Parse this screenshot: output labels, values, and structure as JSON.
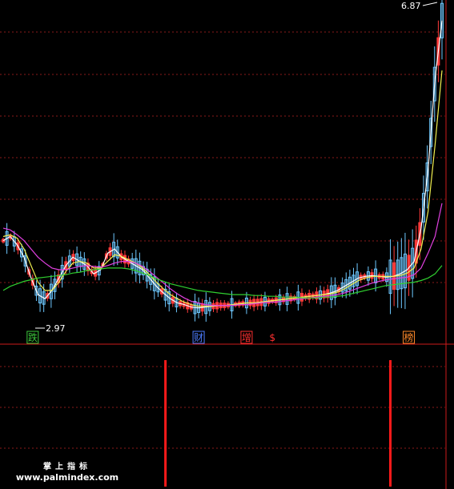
{
  "colors": {
    "background": "#000000",
    "grid": "#8a1a1a",
    "up_candle": "#6ec8ff",
    "down_candle": "#ff3b3b",
    "ma_white": "#ffffff",
    "ma_yellow": "#f0f050",
    "ma_magenta": "#e040e0",
    "ma_green": "#30d030",
    "volume_bar": "#ff1a1a",
    "marker_green": "#3cc83c",
    "marker_blue": "#4c7cff",
    "marker_red": "#ff3030",
    "marker_orange": "#ff8a2a"
  },
  "chart_data": [
    {
      "type": "candlestick",
      "title": "",
      "high_label": "6.87",
      "low_label": "2.97",
      "ylim": [
        2.9,
        6.9
      ],
      "grid": true,
      "x_count": 120,
      "series": [
        {
          "name": "",
          "color_key": "ma_white",
          "values": [
            4.05,
            4.1,
            4.0,
            3.85,
            3.6,
            3.4,
            3.35,
            3.45,
            3.6,
            3.75,
            3.85,
            3.8,
            3.75,
            3.65,
            3.7,
            3.9,
            3.95,
            3.85,
            3.8,
            3.75,
            3.7,
            3.6,
            3.5,
            3.42,
            3.35,
            3.3,
            3.28,
            3.25,
            3.24,
            3.25,
            3.26,
            3.27,
            3.27,
            3.28,
            3.29,
            3.3,
            3.3,
            3.31,
            3.32,
            3.33,
            3.34,
            3.35,
            3.36,
            3.37,
            3.38,
            3.39,
            3.4,
            3.42,
            3.45,
            3.5,
            3.55,
            3.6,
            3.62,
            3.63,
            3.62,
            3.61,
            3.62,
            3.65,
            3.7,
            3.8,
            4.2,
            4.9,
            6.0,
            6.7
          ]
        },
        {
          "name": "",
          "color_key": "ma_yellow",
          "values": [
            4.1,
            4.12,
            4.08,
            3.95,
            3.75,
            3.55,
            3.45,
            3.45,
            3.55,
            3.68,
            3.78,
            3.8,
            3.78,
            3.72,
            3.72,
            3.8,
            3.88,
            3.86,
            3.82,
            3.78,
            3.72,
            3.64,
            3.55,
            3.47,
            3.4,
            3.35,
            3.31,
            3.28,
            3.26,
            3.26,
            3.26,
            3.27,
            3.27,
            3.28,
            3.29,
            3.3,
            3.3,
            3.31,
            3.32,
            3.33,
            3.34,
            3.35,
            3.36,
            3.37,
            3.38,
            3.39,
            3.4,
            3.41,
            3.43,
            3.47,
            3.52,
            3.57,
            3.6,
            3.62,
            3.62,
            3.62,
            3.62,
            3.63,
            3.66,
            3.72,
            3.95,
            4.4,
            5.2,
            6.1
          ]
        },
        {
          "name": "",
          "color_key": "ma_magenta",
          "values": [
            4.2,
            4.18,
            4.12,
            4.05,
            3.95,
            3.85,
            3.78,
            3.72,
            3.7,
            3.7,
            3.72,
            3.74,
            3.75,
            3.74,
            3.73,
            3.75,
            3.78,
            3.8,
            3.8,
            3.78,
            3.74,
            3.68,
            3.61,
            3.54,
            3.47,
            3.41,
            3.36,
            3.32,
            3.3,
            3.28,
            3.27,
            3.27,
            3.27,
            3.27,
            3.28,
            3.28,
            3.29,
            3.3,
            3.31,
            3.31,
            3.32,
            3.33,
            3.34,
            3.35,
            3.36,
            3.37,
            3.38,
            3.39,
            3.4,
            3.42,
            3.45,
            3.48,
            3.51,
            3.54,
            3.56,
            3.58,
            3.59,
            3.6,
            3.61,
            3.64,
            3.72,
            3.9,
            4.1,
            4.5
          ]
        },
        {
          "name": "",
          "color_key": "ma_green",
          "values": [
            3.45,
            3.5,
            3.53,
            3.56,
            3.58,
            3.6,
            3.61,
            3.62,
            3.63,
            3.64,
            3.66,
            3.67,
            3.69,
            3.7,
            3.71,
            3.72,
            3.72,
            3.72,
            3.71,
            3.69,
            3.66,
            3.63,
            3.59,
            3.56,
            3.53,
            3.51,
            3.49,
            3.47,
            3.45,
            3.44,
            3.43,
            3.42,
            3.41,
            3.4,
            3.4,
            3.4,
            3.39,
            3.39,
            3.38,
            3.38,
            3.37,
            3.37,
            3.37,
            3.36,
            3.36,
            3.36,
            3.37,
            3.37,
            3.38,
            3.39,
            3.41,
            3.43,
            3.45,
            3.47,
            3.49,
            3.51,
            3.52,
            3.53,
            3.54,
            3.55,
            3.57,
            3.6,
            3.65,
            3.75
          ]
        }
      ]
    },
    {
      "type": "bar",
      "title": "",
      "bars": [
        {
          "x_index": 44,
          "value": 1
        },
        {
          "x_index": 105,
          "value": 1
        }
      ]
    }
  ],
  "markers": [
    {
      "text": "跌",
      "color_key": "marker_green",
      "x_index": 8
    },
    {
      "text": "财",
      "color_key": "marker_blue",
      "x_index": 53
    },
    {
      "text": "增",
      "color_key": "marker_red",
      "x_index": 66
    },
    {
      "text": "$",
      "color_key": "marker_red",
      "x_index": 73
    },
    {
      "text": "榜",
      "color_key": "marker_orange",
      "x_index": 110
    }
  ],
  "watermark": {
    "cn": "掌上指标",
    "url": "www.palmindex.com"
  }
}
